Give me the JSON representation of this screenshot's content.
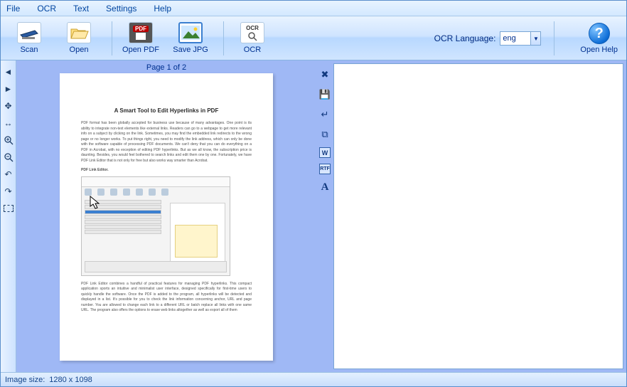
{
  "menu": {
    "file": "File",
    "ocr": "OCR",
    "text": "Text",
    "settings": "Settings",
    "help": "Help"
  },
  "toolbar": {
    "scan": "Scan",
    "open": "Open",
    "open_pdf": "Open PDF",
    "save_jpg": "Save JPG",
    "ocr": "OCR",
    "lang_label": "OCR Language:",
    "lang_value": "eng",
    "open_help": "Open Help"
  },
  "preview": {
    "page_counter": "Page 1 of 2",
    "doc_title": "A Smart Tool to Edit Hyperlinks in PDF",
    "para1": "PDF format has been globally accepted for business use because of many advantages. One point is its ability to integrate non-text elements like external links. Readers can go to a webpage to get more relevant info on a subject by clicking on the link. Sometimes, you may find the embedded link redirects to the wrong page or no longer works. To put things right, you need to modify the link address, which can only be done with the software capable of processing PDF documents. We can't deny that you can do everything on a PDF in Acrobat, with no exception of editing PDF hyperlinks. But as we all know, the subscription price is daunting. Besides, you would feel bothered to search links and edit them one by one. Fortunately, we have PDF Link Editor that is not only for free but also works way smarter than Acrobat.",
    "subhead": "PDF Link Editor.",
    "para2": "PDF Link Editor combines a handful of practical features for managing PDF hyperlinks. This compact application sports an intuitive and minimalist user interface, designed specifically for first-time users to quickly handle the software. Once the PDF is added to the program, all hyperlinks will be detected and displayed in a list. It's possible for you to check the link information concerning anchor, URL and page number. You are allowed to change each link to a different URL or batch replace all links with one same URL. The program also offers the options to erase web links altogether as well as export all of them"
  },
  "status": {
    "label": "Image size:",
    "value": "1280 x   1098"
  }
}
